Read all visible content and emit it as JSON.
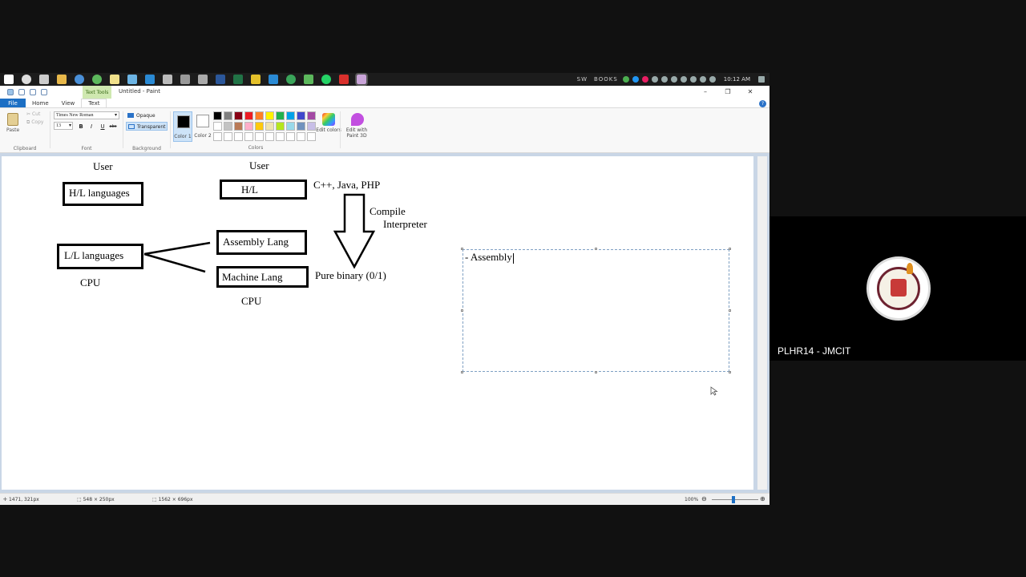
{
  "window": {
    "title": "Untitled - Paint",
    "contextual_tab": "Text Tools",
    "controls": [
      "–",
      "❐",
      "✕"
    ]
  },
  "taskbar": {
    "search_text": "SW",
    "books_text": "BOOKS",
    "clock": "10:12 AM"
  },
  "tabs": {
    "file": "File",
    "home": "Home",
    "view": "View",
    "text": "Text"
  },
  "ribbon": {
    "clipboard": {
      "paste": "Paste",
      "cut": "Cut",
      "copy": "Copy",
      "label": "Clipboard"
    },
    "font": {
      "family": "Times New Roman",
      "size": "13",
      "bold": "B",
      "italic": "I",
      "underline": "U",
      "strike": "abc",
      "label": "Font"
    },
    "background": {
      "opaque": "Opaque",
      "transparent": "Transparent",
      "label": "Background"
    },
    "colors": {
      "color1": "Color 1",
      "color2": "Color 2",
      "label": "Colors",
      "edit_colors": "Edit colors",
      "paint3d": "Edit with Paint 3D",
      "color1_value": "#000000",
      "color2_value": "#ffffff",
      "palette_row1": [
        "#000000",
        "#7f7f7f",
        "#880015",
        "#ed1c24",
        "#ff7f27",
        "#fff200",
        "#22b14c",
        "#00a2e8",
        "#3f48cc",
        "#a349a4"
      ],
      "palette_row2": [
        "#ffffff",
        "#c3c3c3",
        "#b97a57",
        "#ffaec9",
        "#ffc90e",
        "#efe4b0",
        "#b5e61d",
        "#99d9ea",
        "#7092be",
        "#c8bfe7"
      ]
    }
  },
  "canvas": {
    "left_user": "User",
    "hl_languages": "H/L languages",
    "ll_languages": "L/L languages",
    "cpu_left": "CPU",
    "mid_user": "User",
    "hl": "H/L",
    "assembly_lang": "Assembly Lang",
    "machine_lang": "Machine Lang",
    "cpu_mid": "CPU",
    "languages": "C++, Java, PHP",
    "compile": "Compile",
    "interpreter": "Interpreter",
    "pure_binary": "Pure binary (0/1)",
    "textbox_text": "- Assembly"
  },
  "status": {
    "cursor_pos": "1471, 321px",
    "selection_size": "548 × 250px",
    "image_size": "1562 × 696px",
    "zoom": "100%"
  },
  "participant": {
    "name": "PLHR14 - JMCIT"
  }
}
